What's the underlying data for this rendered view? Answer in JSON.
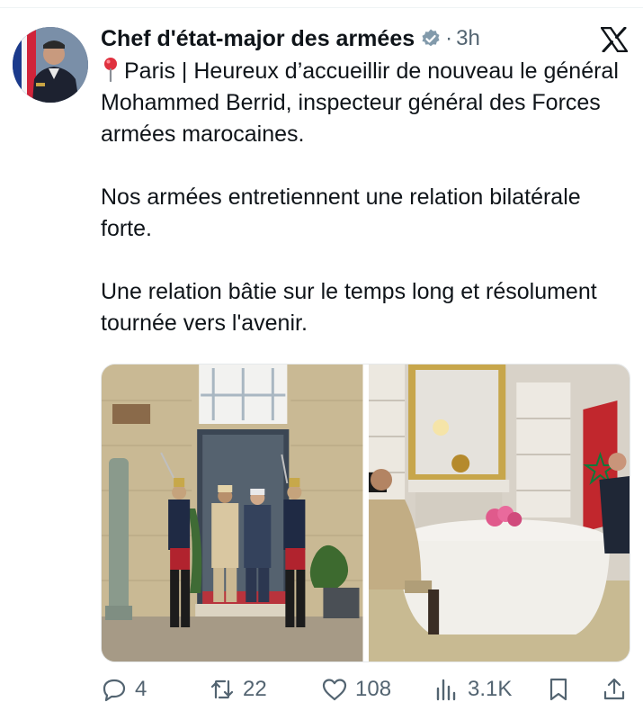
{
  "tweet": {
    "author_name": "Chef d'état-major des armées",
    "separator": "·",
    "timestamp": "3h",
    "location": "Paris",
    "paragraphs": [
      "Paris | Heureux d’accueillir de nouveau le général Mohammed Berrid, inspecteur général des Forces armées marocaines.",
      "Nos armées entretiennent une relation bilatérale forte.",
      "Une relation bâtie sur le temps long et résolument tournée vers l'avenir."
    ],
    "para1_rest": " | Heureux d’accueillir de nouveau le général Mohammed Berrid, inspecteur général des Forces armées marocaines.",
    "para2": "Nos armées entretiennent une relation bilatérale forte.",
    "para3": "Une relation bâtie sur le temps long et résolument tournée vers l'avenir."
  },
  "icons": {
    "avatar": "avatar-photo",
    "verified": "verified-badge-icon",
    "platform": "x-logo-icon",
    "location": "round-pushpin-icon"
  },
  "media": {
    "photo_left_sign": "",
    "photos": [
      "honor-guard-entrance-photo",
      "dining-room-meeting-photo"
    ]
  },
  "actions": {
    "replies": "4",
    "reposts": "22",
    "likes": "108",
    "views": "3.1K"
  },
  "colors": {
    "text": "#0f1419",
    "secondary": "#536471",
    "verified": "#829aab"
  }
}
